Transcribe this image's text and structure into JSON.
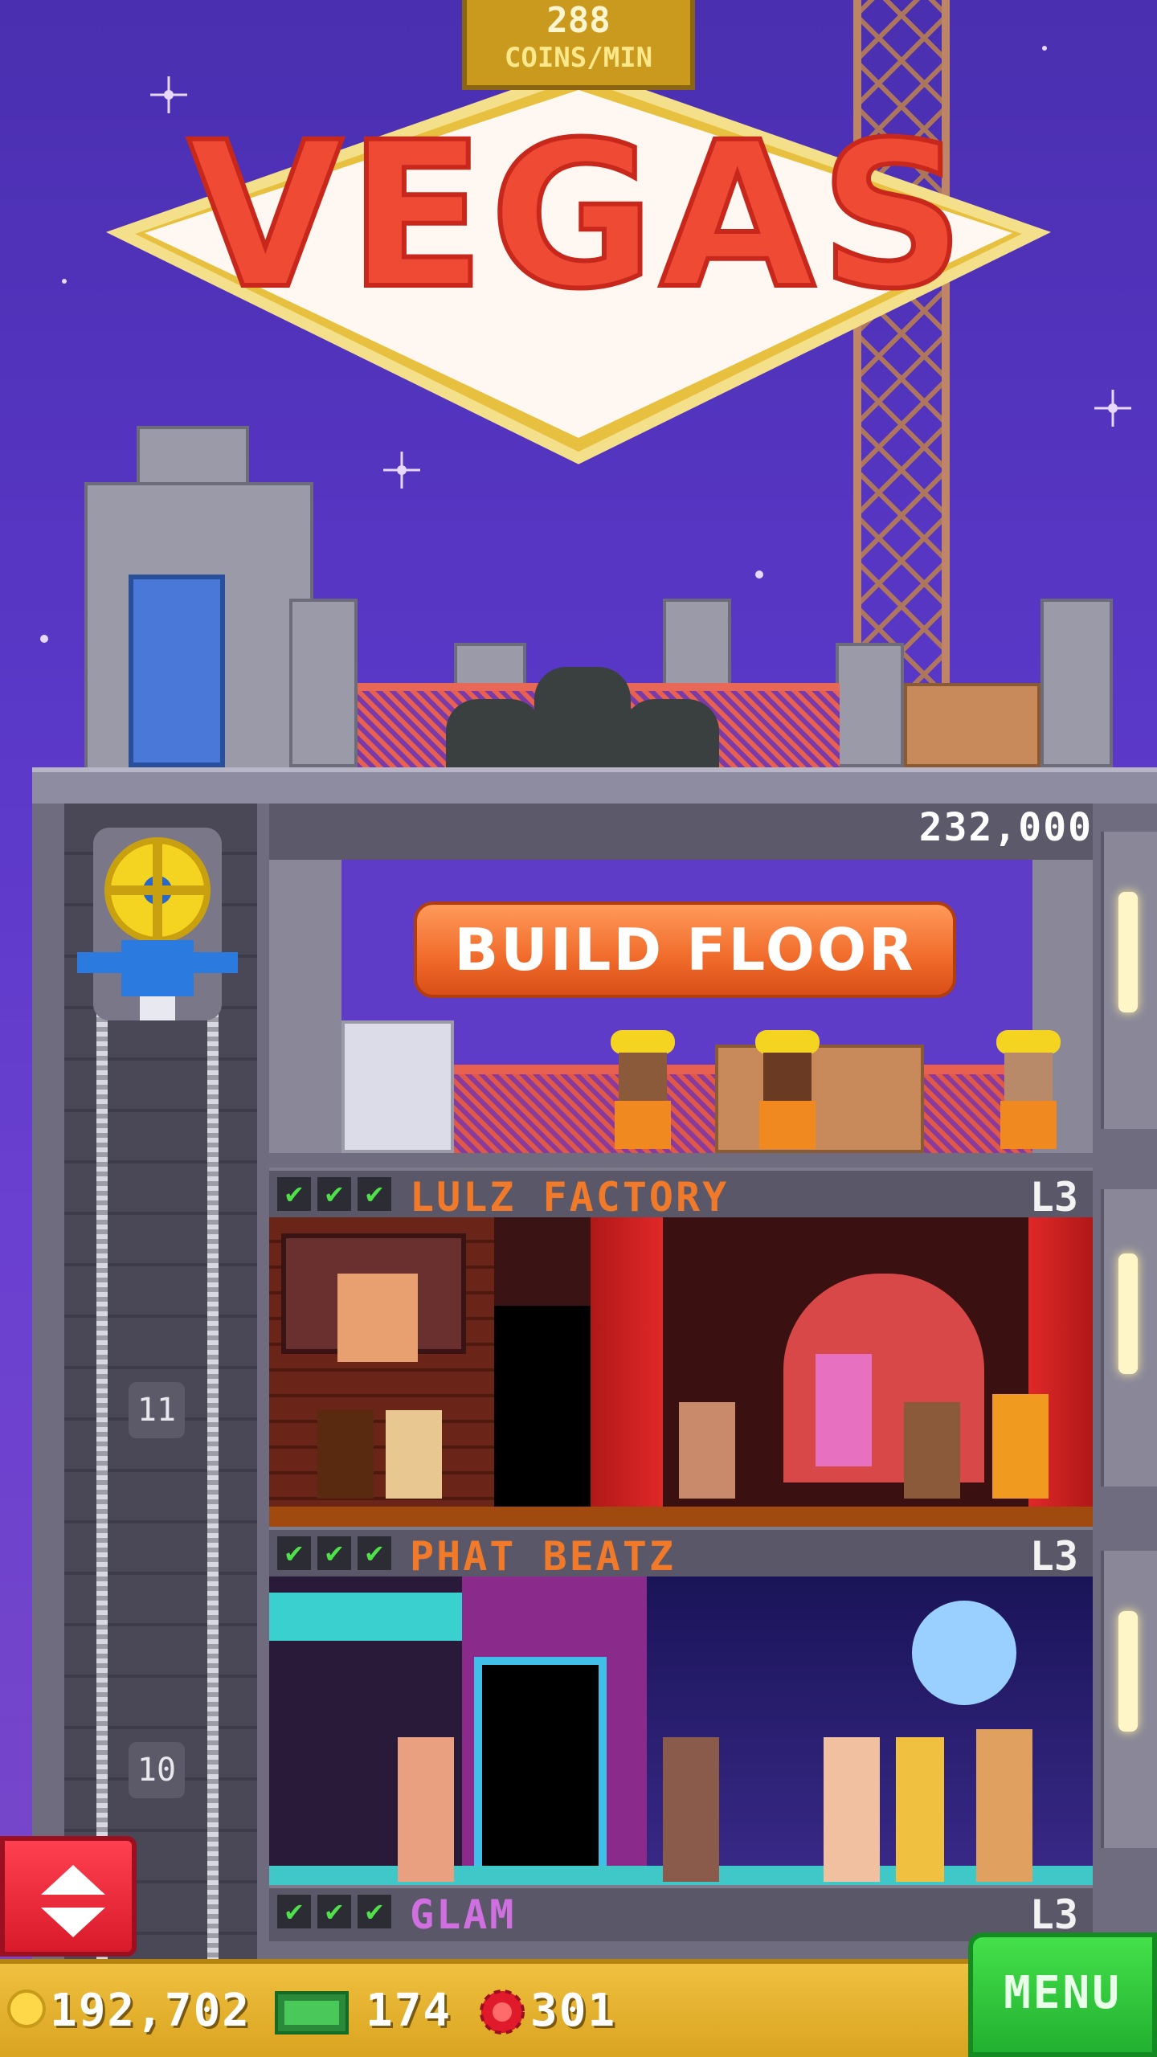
{
  "header": {
    "coins_per_min_value": "288",
    "coins_per_min_label": "COINS/MIN",
    "sign_text": "VEGAS"
  },
  "build_floor": {
    "cost": "232,000",
    "button_label": "BUILD FLOOR"
  },
  "floors": [
    {
      "name": "LULZ FACTORY",
      "level": "L3",
      "name_color": "#f07a2a",
      "checks": 3
    },
    {
      "name": "PHAT BEATZ",
      "level": "L3",
      "name_color": "#f07a2a",
      "checks": 3
    },
    {
      "name": "GLAM",
      "level": "L3",
      "name_color": "#d070e0",
      "checks": 3
    }
  ],
  "shaft_numbers": [
    "11",
    "10"
  ],
  "bottom_bar": {
    "coins": "192,702",
    "bux": "174",
    "chips": "301",
    "menu_label": "MENU"
  },
  "colors": {
    "sky": "#5a38c8",
    "accent_orange": "#f06a2a",
    "check_green": "#4fe04a",
    "menu_green": "#33c83c"
  },
  "icons": [
    "coin-icon",
    "bux-icon",
    "chip-icon",
    "elevator-icon",
    "scroll-arrows-icon"
  ]
}
